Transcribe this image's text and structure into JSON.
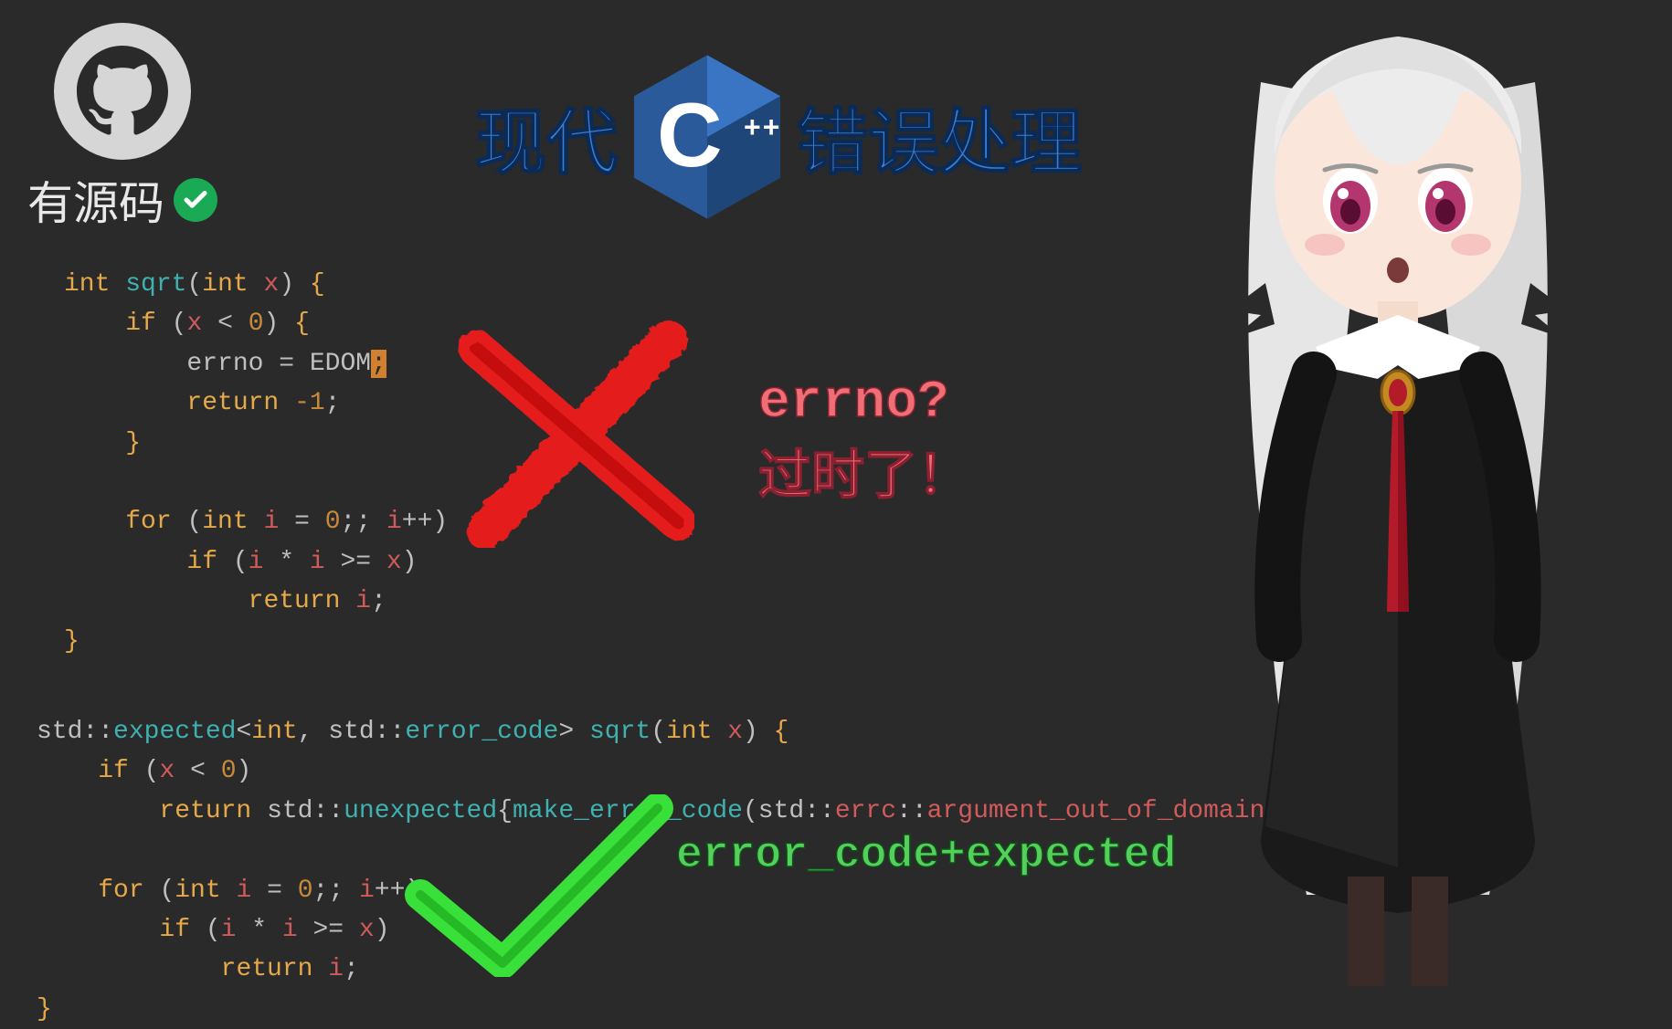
{
  "badge": {
    "source_label": "有源码"
  },
  "title": {
    "left": "现代",
    "right": "错误处理",
    "logo_letter": "C",
    "logo_plus": "++"
  },
  "callouts": {
    "errno_line1": "errno?",
    "errno_line2": "过时了！",
    "modern": "error_code+expected"
  },
  "code1": {
    "l1_int": "int",
    "l1_fn": "sqrt",
    "l1_ptype": "int",
    "l1_pname": "x",
    "l2_if": "if",
    "l2_var": "x",
    "l2_op": "<",
    "l2_num": "0",
    "l3_errno": "errno",
    "l3_eq": " = ",
    "l3_edom": "EDOM",
    "l3_semi": ";",
    "l4_return": "return",
    "l4_val": "-1",
    "l6_for": "for",
    "l6_int": "int",
    "l6_i": "i",
    "l6_eq": " = ",
    "l6_zero": "0",
    "l6_inc_i": "i",
    "l6_inc": "++",
    "l7_if": "if",
    "l7_i1": "i",
    "l7_star": " * ",
    "l7_i2": "i",
    "l7_ge": " >= ",
    "l7_x": "x",
    "l8_return": "return",
    "l8_i": "i"
  },
  "code2": {
    "l1_std1": "std",
    "l1_expected": "expected",
    "l1_int": "int",
    "l1_std2": "std",
    "l1_errcode": "error_code",
    "l1_fn": "sqrt",
    "l1_ptype": "int",
    "l1_pname": "x",
    "l2_if": "if",
    "l2_var": "x",
    "l2_op": "<",
    "l2_num": "0",
    "l3_return": "return",
    "l3_std1": "std",
    "l3_unexpected": "unexpected",
    "l3_make": "make_error_code",
    "l3_std2": "std",
    "l3_errc": "errc",
    "l3_arg": "argument_out_of_domain",
    "l5_for": "for",
    "l5_int": "int",
    "l5_i": "i",
    "l5_zero": "0",
    "l5_inc_i": "i",
    "l5_inc": "++",
    "l6_if": "if",
    "l6_i1": "i",
    "l6_star": " * ",
    "l6_i2": "i",
    "l6_ge": " >= ",
    "l6_x": "x",
    "l7_return": "return",
    "l7_i": "i"
  }
}
